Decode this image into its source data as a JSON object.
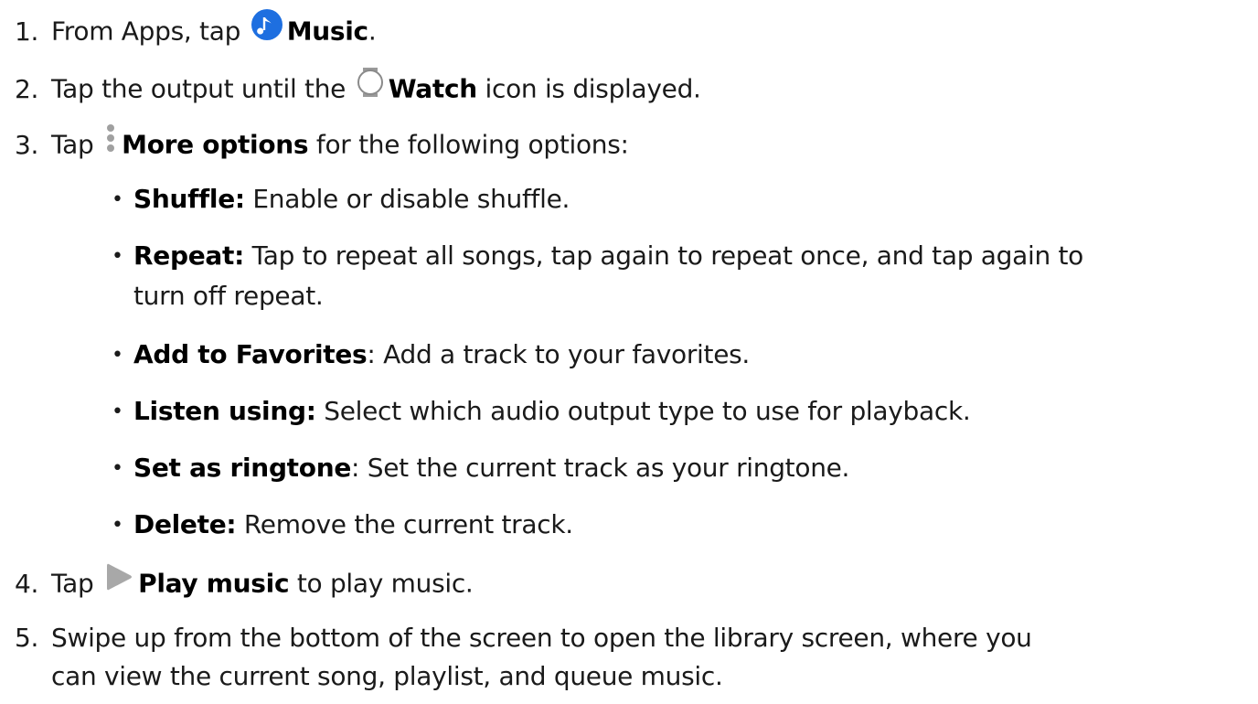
{
  "steps": [
    {
      "num": "1.",
      "pre": "From Apps, tap",
      "icon": "music-app-icon",
      "bold": "Music",
      "post": "."
    },
    {
      "num": "2.",
      "pre": "Tap the output until the",
      "icon": "watch-icon",
      "bold": "Watch",
      "post": " icon is displayed."
    },
    {
      "num": "3.",
      "pre": "Tap",
      "icon": "more-options-icon",
      "bold": "More options",
      "post": " for the following options:"
    },
    {
      "num": "4.",
      "pre": "Tap",
      "icon": "play-icon",
      "bold": "Play music",
      "post": " to play music."
    },
    {
      "num": "5.",
      "text1": "Swipe up from the bottom of the screen to open the library screen, where you",
      "text2": "can view the current song, playlist, and queue music."
    }
  ],
  "options": [
    {
      "bullet": "•",
      "bold": "Shuffle:",
      "text": " Enable or disable shuffle."
    },
    {
      "bullet": "•",
      "bold": "Repeat:",
      "text": " Tap to repeat all songs, tap again to repeat once, and tap again to",
      "text2": "turn off repeat."
    },
    {
      "bullet": "•",
      "bold": "Add to Favorites",
      "text": ": Add a track to your favorites."
    },
    {
      "bullet": "•",
      "bold": "Listen using:",
      "text": " Select which audio output type to use for playback."
    },
    {
      "bullet": "•",
      "bold": "Set as ringtone",
      "text": ": Set the current track as your ringtone."
    },
    {
      "bullet": "•",
      "bold": "Delete:",
      "text": " Remove the current track."
    }
  ],
  "colors": {
    "music_icon": "#1e6fe0",
    "watch_icon": "#8a8a8a",
    "more_dots": "#a0a0a0",
    "play_icon": "#a8a8a8"
  }
}
